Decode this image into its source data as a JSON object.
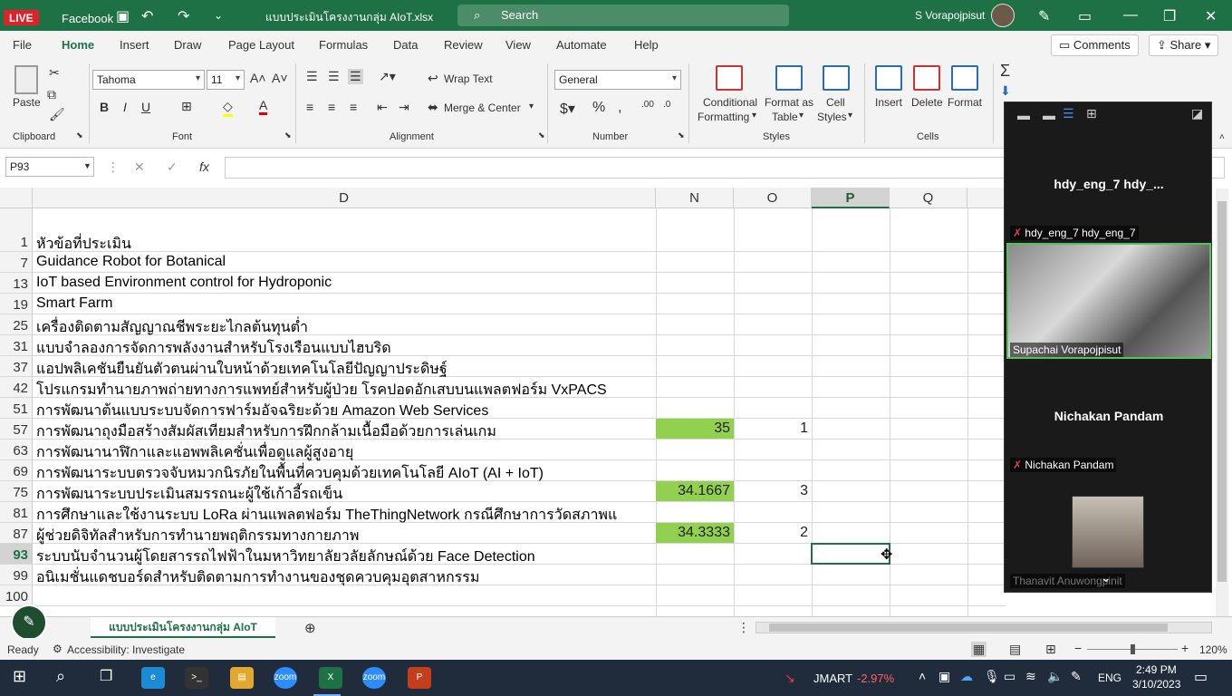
{
  "titlebar": {
    "live": "LIVE",
    "facebook": "Facebook",
    "doc_title": "แบบประเมินโครงงานกลุ่ม AIoT.xlsx",
    "search": "Search",
    "user": "S Vorapojpisut"
  },
  "menu": {
    "items": [
      "File",
      "Home",
      "Insert",
      "Draw",
      "Page Layout",
      "Formulas",
      "Data",
      "Review",
      "View",
      "Automate",
      "Help"
    ],
    "comments": "Comments",
    "share": "Share"
  },
  "ribbon": {
    "paste": "Paste",
    "font_name": "Tahoma",
    "font_size": "11",
    "wrap_text": "Wrap Text",
    "merge_center": "Merge & Center",
    "number_format": "General",
    "conditional": "Conditional",
    "formatting": "Formatting",
    "format_as": "Format as",
    "table": "Table",
    "cell": "Cell",
    "styles_btn": "Styles",
    "insert": "Insert",
    "delete": "Delete",
    "format": "Format",
    "groups": {
      "clipboard": "Clipboard",
      "font": "Font",
      "alignment": "Alignment",
      "number": "Number",
      "styles": "Styles",
      "cells": "Cells"
    }
  },
  "formula": {
    "namebox": "P93",
    "fx": "fx"
  },
  "columns": {
    "D": "D",
    "N": "N",
    "O": "O",
    "P": "P",
    "Q": "Q"
  },
  "rows": [
    {
      "num": "1",
      "label": "หัวข้อที่ประเมิน",
      "n": "",
      "o": ""
    },
    {
      "num": "7",
      "label": "Guidance Robot for Botanical",
      "n": "",
      "o": ""
    },
    {
      "num": "13",
      "label": "IoT based Environment control for Hydroponic",
      "n": "",
      "o": ""
    },
    {
      "num": "19",
      "label": "Smart Farm",
      "n": "",
      "o": ""
    },
    {
      "num": "25",
      "label": "เครื่องติดตามสัญญาณชีพระยะไกลต้นทุนต่ำ",
      "n": "",
      "o": ""
    },
    {
      "num": "31",
      "label": "แบบจำลองการจัดการพลังงานสำหรับโรงเรือนแบบไฮบริด",
      "n": "",
      "o": ""
    },
    {
      "num": "37",
      "label": "แอปพลิเคชันยืนยันตัวตนผ่านใบหน้าด้วยเทคโนโลยีปัญญาประดิษฐ์",
      "n": "",
      "o": ""
    },
    {
      "num": "42",
      "label": "โปรแกรมทำนายภาพถ่ายทางการแพทย์สำหรับผู้ป่วย โรคปอดอักเสบบนแพลตฟอร์ม VxPACS",
      "n": "",
      "o": ""
    },
    {
      "num": "51",
      "label": "การพัฒนาต้นแบบระบบจัดการฟาร์มอัจฉริยะด้วย Amazon Web Services",
      "n": "",
      "o": ""
    },
    {
      "num": "57",
      "label": "การพัฒนาถุงมือสร้างสัมผัสเทียมสำหรับการฝึกกล้ามเนื้อมือด้วยการเล่นเกม",
      "n": "35",
      "o": "1"
    },
    {
      "num": "63",
      "label": "การพัฒนานาฬิกาและแอพพลิเคชั่นเพื่อดูแลผู้สูงอายุ",
      "n": "",
      "o": ""
    },
    {
      "num": "69",
      "label": "การพัฒนาระบบตรวจจับหมวกนิรภัยในพื้นที่ควบคุมด้วยเทคโนโลยี AIoT (AI + IoT)",
      "n": "",
      "o": ""
    },
    {
      "num": "75",
      "label": "การพัฒนาระบบประเมินสมรรถนะผู้ใช้เก้าอี้รถเข็น",
      "n": "34.1667",
      "o": "3"
    },
    {
      "num": "81",
      "label": "การศึกษาและใช้งานระบบ LoRa ผ่านแพลตฟอร์ม TheThingNetwork กรณีศึกษาการวัดสภาพแ",
      "n": "",
      "o": ""
    },
    {
      "num": "87",
      "label": "ผู้ช่วยดิจิทัลสำหรับการทำนายพฤติกรรมทางกายภาพ",
      "n": "34.3333",
      "o": "2"
    },
    {
      "num": "93",
      "label": "ระบบนับจำนวนผู้โดยสารรถไฟฟ้าในมหาวิทยาลัยวลัยลักษณ์ด้วย Face Detection",
      "n": "",
      "o": ""
    },
    {
      "num": "99",
      "label": "อนิเมชั่นแดชบอร์ดสำหรับติดตามการทำงานของชุดควบคุมอุตสาหกรรม",
      "n": "",
      "o": ""
    },
    {
      "num": "100",
      "label": "",
      "n": "",
      "o": ""
    }
  ],
  "sheet_tab": "แบบประเมินโครงงานกลุ่ม AIoT",
  "status": {
    "ready": "Ready",
    "accessibility": "Accessibility: Investigate",
    "zoom": "120%"
  },
  "zoom_panel": {
    "top_name": "hdy_eng_7  hdy_...",
    "video1_label": "hdy_eng_7 hdy_eng_7",
    "video1_person": "Supachai Vorapojpisut",
    "name2": "Nichakan Pandam",
    "label2": "Nichakan Pandam",
    "label3": "Thanavit Anuwongpinit"
  },
  "taskbar": {
    "stock": "JMART",
    "change": "-2.97%",
    "lang": "ENG",
    "time": "2:49 PM",
    "date": "3/10/2023"
  }
}
